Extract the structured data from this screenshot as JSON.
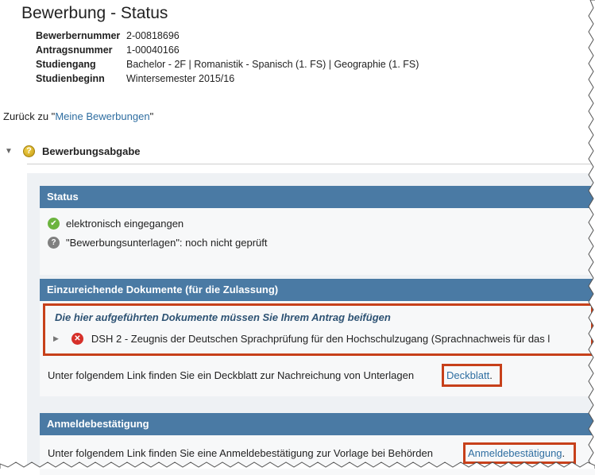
{
  "page": {
    "title": "Bewerbung - Status",
    "info": [
      {
        "label": "Bewerbernummer",
        "value": "2-00818696"
      },
      {
        "label": "Antragsnummer",
        "value": "1-00040166"
      },
      {
        "label": "Studiengang",
        "value": "Bachelor - 2F | Romanistik - Spanisch (1. FS) | Geographie (1. FS)"
      },
      {
        "label": "Studienbeginn",
        "value": "Wintersemester 2015/16"
      }
    ],
    "back": {
      "prefix": "Zurück zu \"",
      "link": "Meine Bewerbungen",
      "suffix": "\""
    }
  },
  "section": {
    "title": "Bewerbungsabgabe",
    "status": {
      "heading": "Status",
      "items": [
        {
          "icon": "check-icon",
          "text": "elektronisch eingegangen"
        },
        {
          "icon": "question-icon",
          "text": "\"Bewerbungsunterlagen\": noch nicht geprüft"
        }
      ]
    },
    "documents": {
      "heading": "Einzureichende Dokumente (für die Zulassung)",
      "required_title": "Die hier aufgeführten Dokumente müssen Sie Ihrem Antrag beifügen",
      "required_item": "DSH 2 - Zeugnis der Deutschen Sprachprüfung für den Hochschulzugang (Sprachnachweis für das l",
      "cover_text": "Unter folgendem Link finden Sie ein Deckblatt zur Nachreichung von Unterlagen",
      "cover_link": "Deckblatt",
      "cover_suffix": "."
    },
    "confirmation": {
      "heading": "Anmeldebestätigung",
      "text": "Unter folgendem Link finden Sie eine Anmeldebestätigung zur Vorlage bei Behörden",
      "link": "Anmeldebestätigung",
      "suffix": "."
    }
  },
  "colors": {
    "header_blue": "#4a7aa4",
    "link_blue": "#2f6ea1",
    "highlight_red": "#c7401a",
    "ok_green": "#6cb43f",
    "error_red": "#d6302a"
  }
}
